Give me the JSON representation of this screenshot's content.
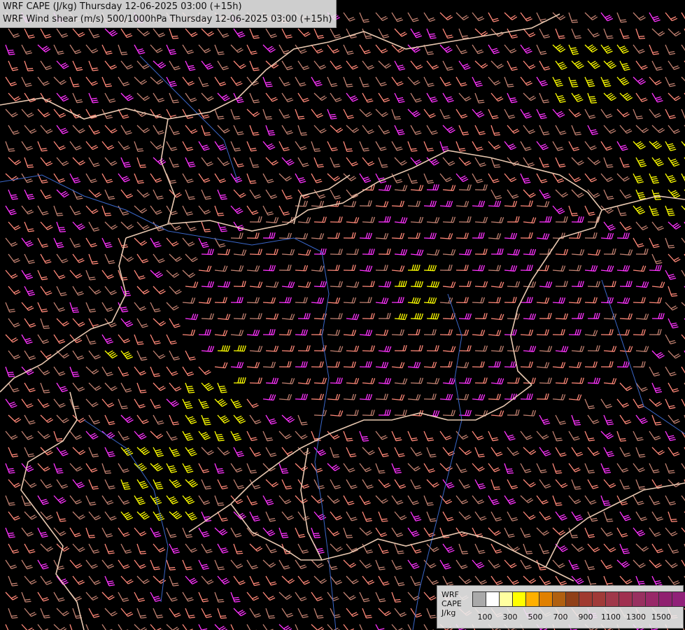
{
  "titles": {
    "line1": "WRF CAPE (J/kg) Thursday 12-06-2025 03:00 (+15h)",
    "line2": "WRF Wind shear (m/s) 500/1000hPa Thursday 12-06-2025 03:00 (+15h)"
  },
  "legend": {
    "line1": "WRF",
    "line2": "CAPE",
    "line3": "J/kg",
    "colors": [
      "#a9a9a9",
      "#ffffff",
      "#ffffa0",
      "#ffff00",
      "#ffb000",
      "#e08000",
      "#b06010",
      "#904018",
      "#a03a30",
      "#a03a38",
      "#a0384a",
      "#a03050",
      "#983060",
      "#982868",
      "#902070",
      "#902078",
      "#902080"
    ],
    "tick_labels": [
      "100",
      "300",
      "500",
      "700",
      "900",
      "1100",
      "1300",
      "1500"
    ]
  },
  "map": {
    "barb_colors": {
      "weak": "#c08070",
      "moderate": "#ff8878",
      "strong": "#ff33ff",
      "very_strong": "#ffff00"
    },
    "border_color": "#e8c8b0",
    "river_color": "#3a66c8"
  }
}
